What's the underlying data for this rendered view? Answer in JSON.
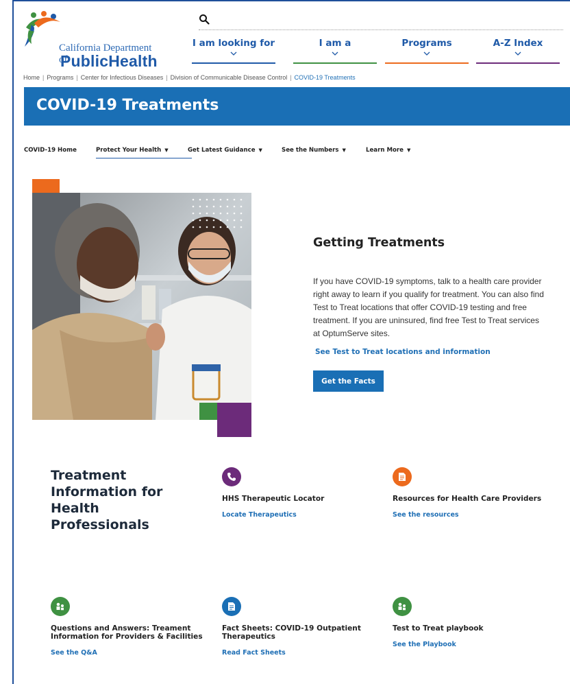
{
  "logo": {
    "line1": "California Department of",
    "line2": "PublicHealth"
  },
  "topnav": [
    {
      "label": "I am looking for",
      "color": "#1f5aa8"
    },
    {
      "label": "I am a",
      "color": "#3f9142"
    },
    {
      "label": "Programs",
      "color": "#ec6a1d"
    },
    {
      "label": "A-Z Index",
      "color": "#6c2b7a"
    }
  ],
  "breadcrumb": [
    "Home",
    "Programs",
    "Center for Infectious Diseases",
    "Division of Communicable Disease Control",
    "COVID-19 Treatments"
  ],
  "page_title": "COVID-19 Treatments",
  "subnav": [
    {
      "label": "COVID-19 Home",
      "has_dropdown": false
    },
    {
      "label": "Protect Your Health",
      "has_dropdown": true
    },
    {
      "label": "Get Latest Guidance",
      "has_dropdown": true
    },
    {
      "label": "See the Numbers",
      "has_dropdown": true
    },
    {
      "label": "Learn More",
      "has_dropdown": true
    }
  ],
  "getting": {
    "title": "Getting Treatments",
    "body": "If you have COVID-19 symptoms, talk to a health care provider right away to learn if you qualify for treatment. You can also find Test to Treat locations that offer COVID-19 testing and free treatment. If you are uninsured, find free Test to Treat services at OptumServe sites.",
    "link": "See Test to Treat locations and information",
    "button": "Get the Facts"
  },
  "treatment_info": {
    "heading": "Treatment Information for Health Professionals",
    "cards": [
      {
        "icon": "phone-icon",
        "color": "#6c2b7a",
        "title": "HHS Therapeutic Locator",
        "link": "Locate Therapeutics"
      },
      {
        "icon": "document-icon",
        "color": "#ec6a1d",
        "title": "Resources for Health Care Providers",
        "link": "See the resources"
      },
      {
        "icon": "people-icon",
        "color": "#3f9142",
        "title": "Questions and Answers: Treament Information for Providers & Facilities",
        "link": "See the Q&A"
      },
      {
        "icon": "document-icon",
        "color": "#1a6fb5",
        "title": "Fact Sheets: COVID-19 Outpatient Therapeutics",
        "link": "Read Fact Sheets"
      },
      {
        "icon": "people-icon",
        "color": "#3f9142",
        "title": "Test to Treat playbook",
        "link": "See the Playbook"
      }
    ]
  }
}
